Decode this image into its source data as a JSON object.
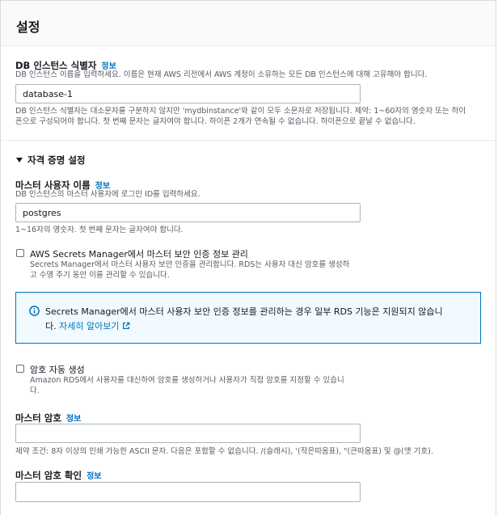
{
  "header": {
    "title": "설정"
  },
  "db_identifier": {
    "label": "DB 인스턴스 식별자",
    "info": "정보",
    "description": "DB 인스턴스 이름을 입력하세요. 이름은 현재 AWS 리전에서 AWS 계정이 소유하는 모든 DB 인스턴스에 대해 고유해야 합니다.",
    "value": "database-1",
    "constraint_line1": "DB 인스턴스 식별자는 대소문자를 구분하지 않지만 'mydbinstance'와 같이 모두 소문자로 저장됩니다. 제약: 1~60자의 영숫자 또는 하이",
    "constraint_line2": "픈으로 구성되어야 합니다. 첫 번째 문자는 글자여야 합니다. 하이픈 2개가 연속될 수 없습니다. 하이픈으로 끝날 수 없습니다."
  },
  "credentials": {
    "toggle_icon": "caret-down-icon",
    "title": "자격 증명 설정",
    "master_username": {
      "label": "마스터 사용자 이름",
      "info": "정보",
      "description": "DB 인스턴스의 마스터 사용자에 로그인 ID를 입력하세요.",
      "value": "postgres",
      "constraint": "1~16자의 영숫자. 첫 번째 문자는 글자여야 합니다."
    },
    "secrets_manager": {
      "checked": false,
      "label": "AWS Secrets Manager에서 마스터 보안 인증 정보 관리",
      "desc_line1": "Secrets Manager에서 마스터 사용자 보안 인증을 관리합니다. RDS는 사용자 대신 암호를 생성하",
      "desc_line2": "고 수명 주기 동안 이를 관리할 수 있습니다."
    },
    "alert": {
      "icon": "info-circle-icon",
      "text": "Secrets Manager에서 마스터 사용자 보안 인증 정보를 관리하는 경우 일부 RDS 기능은 지원되지 않습니",
      "text2": "다.",
      "link": "자세히 알아보기",
      "link_icon": "external-link-icon"
    },
    "auto_password": {
      "checked": false,
      "label": "암호 자동 생성",
      "desc_line1": "Amazon RDS에서 사용자를 대신하여 암호를 생성하거나 사용자가 직접 암호를 지정할 수 있습니",
      "desc_line2": "다."
    },
    "master_password": {
      "label": "마스터 암호",
      "info": "정보",
      "value": "",
      "constraint": "제약 조건: 8자 이상의 인쇄 가능한 ASCII 문자. 다음은 포함할 수 없습니다. /(슬래시), '(작은따옴표), \"(큰따옴표) 및 @(앳 기호)."
    },
    "confirm_password": {
      "label": "마스터 암호 확인",
      "info": "정보",
      "value": ""
    }
  }
}
